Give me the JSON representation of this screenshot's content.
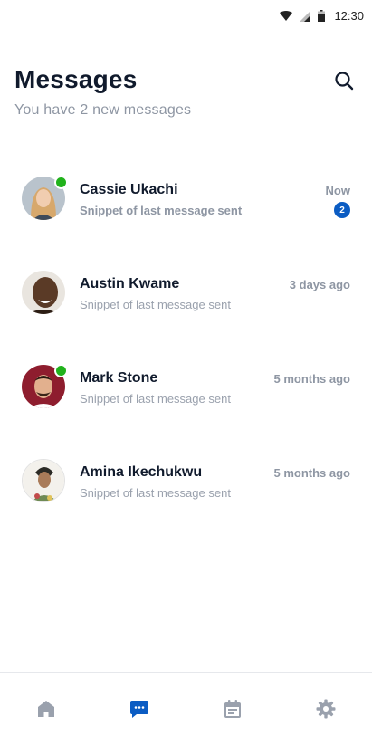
{
  "status_bar": {
    "time": "12:30",
    "icons": [
      "wifi-icon",
      "signal-icon",
      "battery-icon"
    ]
  },
  "header": {
    "title": "Messages",
    "subtitle": "You have 2 new messages",
    "search_icon": "search-icon"
  },
  "conversations": [
    {
      "name": "Cassie Ukachi",
      "snippet": "Snippet of last message sent",
      "time": "Now",
      "unread_count": "2",
      "online": true,
      "unread": true,
      "avatar_color": "#c9a27a"
    },
    {
      "name": "Austin Kwame",
      "snippet": "Snippet of last message sent",
      "time": "3 days ago",
      "unread_count": "",
      "online": false,
      "unread": false,
      "avatar_color": "#5a3a26"
    },
    {
      "name": "Mark Stone",
      "snippet": "Snippet of last message sent",
      "time": "5 months ago",
      "unread_count": "",
      "online": true,
      "unread": false,
      "avatar_color": "#8e1d2e"
    },
    {
      "name": "Amina Ikechukwu",
      "snippet": "Snippet of last message sent",
      "time": "5 months ago",
      "unread_count": "",
      "online": false,
      "unread": false,
      "avatar_color": "#d8d3cb"
    }
  ],
  "bottom_nav": {
    "items": [
      "home-icon",
      "messages-icon",
      "calendar-icon",
      "settings-icon"
    ],
    "active": "messages-icon"
  },
  "colors": {
    "accent": "#0b5cc3",
    "online": "#21b21c",
    "inactive_nav": "#9aa1ad"
  }
}
